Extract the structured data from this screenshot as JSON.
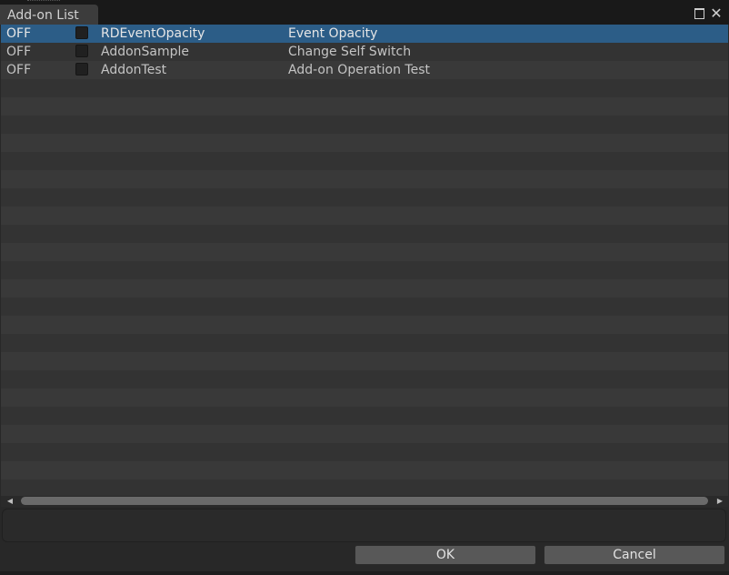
{
  "window": {
    "title": "Add-on List",
    "controls": {
      "maximize_icon": "maximize-icon",
      "close_icon": "close-icon",
      "close_glyph": "✕"
    }
  },
  "addons": {
    "rows": [
      {
        "state": "OFF",
        "name": "RDEventOpacity",
        "description": "Event Opacity",
        "checked": false,
        "selected": true
      },
      {
        "state": "OFF",
        "name": "AddonSample",
        "description": "Change Self Switch",
        "checked": false,
        "selected": false
      },
      {
        "state": "OFF",
        "name": "AddonTest",
        "description": "Add-on Operation Test",
        "checked": false,
        "selected": false
      }
    ]
  },
  "scrollbar": {
    "left_arrow": "◀",
    "right_arrow": "▶"
  },
  "description_box": {
    "text": ""
  },
  "footer": {
    "ok_label": "OK",
    "cancel_label": "Cancel"
  },
  "colors": {
    "selection": "#2c5d87",
    "background": "#393939",
    "row_alt": "#333333"
  }
}
